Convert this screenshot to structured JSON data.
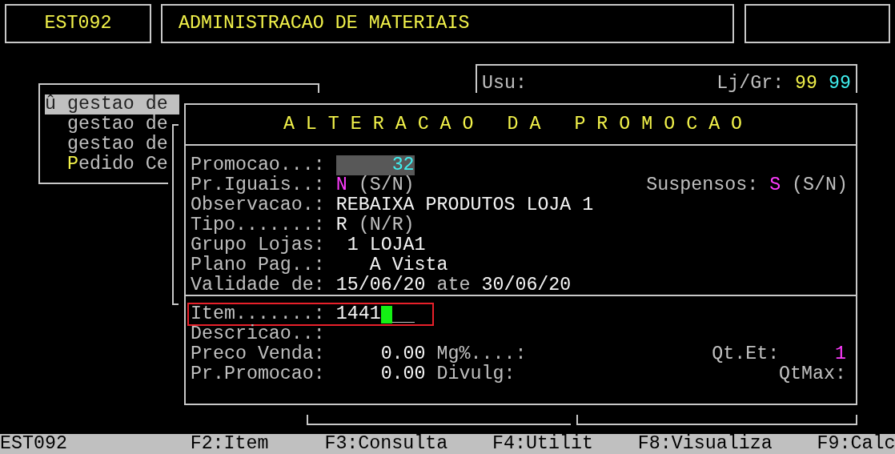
{
  "header": {
    "program": "EST092",
    "title": "ADMINISTRACAO DE MATERIAIS"
  },
  "user_panel": {
    "user_label": "Usu:",
    "store_label": "Lj/Gr:",
    "store": "99",
    "group": "99"
  },
  "menu": {
    "items": [
      {
        "marker": "û",
        "label": "gestao de",
        "selected": true,
        "hotkey": false
      },
      {
        "label": "gestao de",
        "selected": false,
        "hotkey": false
      },
      {
        "label": "gestao de",
        "selected": false,
        "hotkey": false
      },
      {
        "label": "Pedido Ce",
        "selected": false,
        "hotkey": true
      }
    ]
  },
  "dialog": {
    "title": "A L T E R A C A O   D A   P R O M O C A O",
    "rows": [
      {
        "left": [
          {
            "text": "Promocao...:",
            "kind": "label"
          },
          {
            "text": "32",
            "kind": "field"
          }
        ]
      },
      {
        "left": [
          {
            "text": "Pr.Iguais..:",
            "kind": "label"
          },
          {
            "text": "N",
            "kind": "flag"
          },
          {
            "text": "(S/N)",
            "kind": "hint"
          }
        ],
        "right": [
          {
            "text": "Suspensos:",
            "kind": "label"
          },
          {
            "text": "S",
            "kind": "flag"
          },
          {
            "text": "(S/N)",
            "kind": "hint"
          }
        ]
      },
      {
        "left": [
          {
            "text": "Observacao.:",
            "kind": "label"
          },
          {
            "text": "REBAIXA PRODUTOS LOJA 1",
            "kind": "value"
          }
        ]
      },
      {
        "left": [
          {
            "text": "Tipo.......:",
            "kind": "label"
          },
          {
            "text": "R",
            "kind": "value"
          },
          {
            "text": "(N/R)",
            "kind": "hint"
          }
        ]
      },
      {
        "left": [
          {
            "text": "Grupo Lojas:",
            "kind": "label"
          },
          {
            "text": "1",
            "kind": "code"
          },
          {
            "text": "LOJA1",
            "kind": "value"
          }
        ]
      },
      {
        "left": [
          {
            "text": "Plano Pag..:",
            "kind": "label"
          },
          {
            "text": "A Vista",
            "kind": "plan"
          }
        ]
      },
      {
        "left": [
          {
            "text": "Validade de:",
            "kind": "label"
          },
          {
            "text": "15/06/20",
            "kind": "value"
          },
          {
            "text": "ate",
            "kind": "hint"
          },
          {
            "text": "30/06/20",
            "kind": "value"
          }
        ]
      }
    ],
    "item_rows": [
      {
        "left": [
          {
            "text": "Item.......:",
            "kind": "label"
          },
          {
            "text": "1441",
            "kind": "input"
          }
        ],
        "highlighted": true,
        "cursor": true
      },
      {
        "left": [
          {
            "text": "Descricao..:",
            "kind": "label"
          }
        ],
        "highlighted": false
      },
      {
        "left": [
          {
            "text": "Preco Venda:",
            "kind": "label"
          },
          {
            "text": "0.00",
            "kind": "amount"
          },
          {
            "text": "Mg%....:",
            "kind": "label"
          }
        ],
        "right": [
          {
            "text": "Qt.Et:",
            "kind": "label"
          },
          {
            "text": "1",
            "kind": "qty"
          }
        ],
        "highlighted": false
      },
      {
        "left": [
          {
            "text": "Pr.Promocao:",
            "kind": "label"
          },
          {
            "text": "0.00",
            "kind": "amount"
          },
          {
            "text": "Divulg:",
            "kind": "label"
          }
        ],
        "right": [
          {
            "text": "QtMax:",
            "kind": "label"
          }
        ],
        "highlighted": false
      }
    ]
  },
  "status_bar": {
    "program": "EST092",
    "keys": [
      "F2:Item",
      "F3:Consulta",
      "F4:Utilit",
      "F8:Visualiza",
      "F9:Calc"
    ]
  }
}
